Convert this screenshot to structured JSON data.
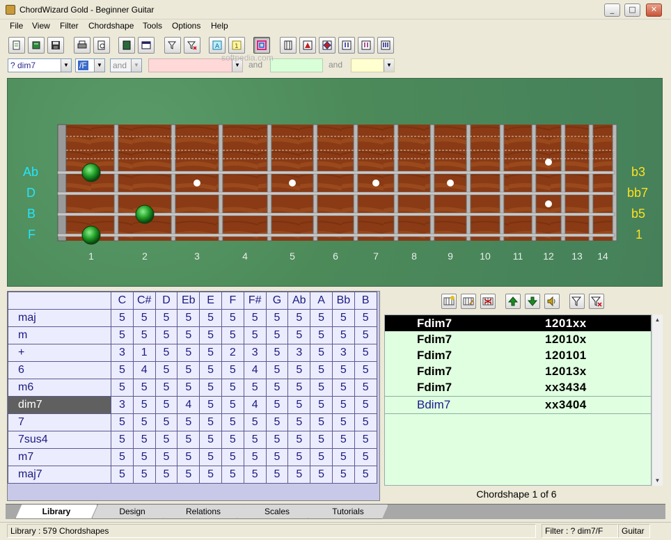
{
  "window": {
    "title": "ChordWizard Gold - Beginner Guitar",
    "minimize_glyph": "_",
    "maximize_glyph": "□",
    "close_glyph": "✕"
  },
  "menu": [
    "File",
    "View",
    "Filter",
    "Chordshape",
    "Tools",
    "Options",
    "Help"
  ],
  "toolbar": {
    "buttons": [
      "new-icon",
      "open-icon",
      "save-icon",
      "print-icon",
      "print-preview-icon",
      "book-icon",
      "keyboard-icon",
      "filter-icon",
      "clear-filter-icon",
      "text-a-icon",
      "text-1-icon",
      "color-frame-icon",
      "guitar-neck-icon",
      "triangle-a-icon",
      "diamond-icon",
      "notes-1-icon",
      "notes-2-icon",
      "notes-3-icon"
    ],
    "watermark": "softpedia.com"
  },
  "filters": {
    "chord_value": "? dim7",
    "bass_value": "/F",
    "and_label": "and",
    "and2_label": "and"
  },
  "fretboard": {
    "string_notes": [
      "Ab",
      "D",
      "B",
      "F"
    ],
    "degrees": [
      "b3",
      "bb7",
      "b5",
      "1"
    ],
    "fret_numbers": [
      "1",
      "2",
      "3",
      "4",
      "5",
      "6",
      "7",
      "8",
      "9",
      "10",
      "11",
      "12",
      "13",
      "14"
    ],
    "finger_positions": [
      {
        "string": 1,
        "fret": 1
      },
      {
        "string": 3,
        "fret": 2
      },
      {
        "string": 4,
        "fret": 1
      }
    ],
    "inlay_frets": [
      3,
      5,
      7,
      9,
      12
    ],
    "colors": {
      "wood": "#8a3a14",
      "board_bg": "#4c8a5a",
      "note_label": "#22e6ff",
      "degree_label": "#ffe020",
      "finger": "#1e8a24"
    }
  },
  "library": {
    "columns": [
      "C",
      "C#",
      "D",
      "Eb",
      "E",
      "F",
      "F#",
      "G",
      "Ab",
      "A",
      "Bb",
      "B"
    ],
    "rows": [
      {
        "name": "maj",
        "values": [
          "5",
          "5",
          "5",
          "5",
          "5",
          "5",
          "5",
          "5",
          "5",
          "5",
          "5",
          "5"
        ]
      },
      {
        "name": "m",
        "values": [
          "5",
          "5",
          "5",
          "5",
          "5",
          "5",
          "5",
          "5",
          "5",
          "5",
          "5",
          "5"
        ]
      },
      {
        "name": "+",
        "values": [
          "3",
          "1",
          "5",
          "5",
          "5",
          "2",
          "3",
          "5",
          "3",
          "5",
          "3",
          "5"
        ]
      },
      {
        "name": "6",
        "values": [
          "5",
          "4",
          "5",
          "5",
          "5",
          "5",
          "4",
          "5",
          "5",
          "5",
          "5",
          "5"
        ]
      },
      {
        "name": "m6",
        "values": [
          "5",
          "5",
          "5",
          "5",
          "5",
          "5",
          "5",
          "5",
          "5",
          "5",
          "5",
          "5"
        ]
      },
      {
        "name": "dim7",
        "values": [
          "3",
          "5",
          "5",
          "4",
          "5",
          "5",
          "4",
          "5",
          "5",
          "5",
          "5",
          "5"
        ],
        "selected": true
      },
      {
        "name": "7",
        "values": [
          "5",
          "5",
          "5",
          "5",
          "5",
          "5",
          "5",
          "5",
          "5",
          "5",
          "5",
          "5"
        ]
      },
      {
        "name": "7sus4",
        "values": [
          "5",
          "5",
          "5",
          "5",
          "5",
          "5",
          "5",
          "5",
          "5",
          "5",
          "5",
          "5"
        ]
      },
      {
        "name": "m7",
        "values": [
          "5",
          "5",
          "5",
          "5",
          "5",
          "5",
          "5",
          "5",
          "5",
          "5",
          "5",
          "5"
        ]
      },
      {
        "name": "maj7",
        "values": [
          "5",
          "5",
          "5",
          "5",
          "5",
          "5",
          "5",
          "5",
          "5",
          "5",
          "5",
          "5"
        ]
      }
    ]
  },
  "chordshapes": {
    "toolbar_icons": [
      "add-shape-icon",
      "edit-shape-icon",
      "delete-shape-icon",
      "move-up-icon",
      "move-down-icon",
      "speaker-icon",
      "filter-icon",
      "clear-filter-icon"
    ],
    "items": [
      {
        "name": "Fdim7",
        "fingering": "1201xx",
        "selected": true
      },
      {
        "name": "Fdim7",
        "fingering": "12010x"
      },
      {
        "name": "Fdim7",
        "fingering": "120101"
      },
      {
        "name": "Fdim7",
        "fingering": "12013x"
      },
      {
        "name": "Fdim7",
        "fingering": "xx3434"
      },
      {
        "name": "Bdim7",
        "fingering": "xx3404",
        "alt": true
      }
    ],
    "count_text": "Chordshape 1 of 6"
  },
  "tabs": [
    {
      "label": "Library",
      "active": true
    },
    {
      "label": "Design"
    },
    {
      "label": "Relations"
    },
    {
      "label": "Scales"
    },
    {
      "label": "Tutorials"
    }
  ],
  "status": {
    "left": "Library  :  579 Chordshapes",
    "filter": "Filter  :  ? dim7/F",
    "instrument": "Guitar"
  }
}
